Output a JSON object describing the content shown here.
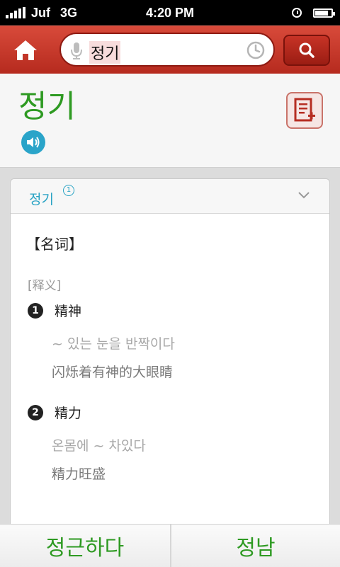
{
  "status_bar": {
    "carrier": "Juf",
    "network": "3G",
    "time": "4:20 PM",
    "battery_level": 0.8
  },
  "header": {
    "search_value": "정기"
  },
  "word": {
    "headword": "정기"
  },
  "entry": {
    "title": "정기",
    "sup": "1",
    "pos": "【名词】",
    "section_label": "[释义]",
    "senses": [
      {
        "num": "1",
        "meaning": "精神",
        "example_ko": "~ 있는 눈을 반짝이다",
        "example_zh": "闪烁着有神的大眼睛"
      },
      {
        "num": "2",
        "meaning": "精力",
        "example_ko": "온몸에 ~ 차있다",
        "example_zh": "精力旺盛"
      }
    ]
  },
  "bottom_nav": {
    "prev_label": "정근하다",
    "next_label": "정남"
  },
  "colors": {
    "header_red": "#c0392b",
    "headword_green": "#2e9a22",
    "accent_teal": "#29a3c4"
  }
}
